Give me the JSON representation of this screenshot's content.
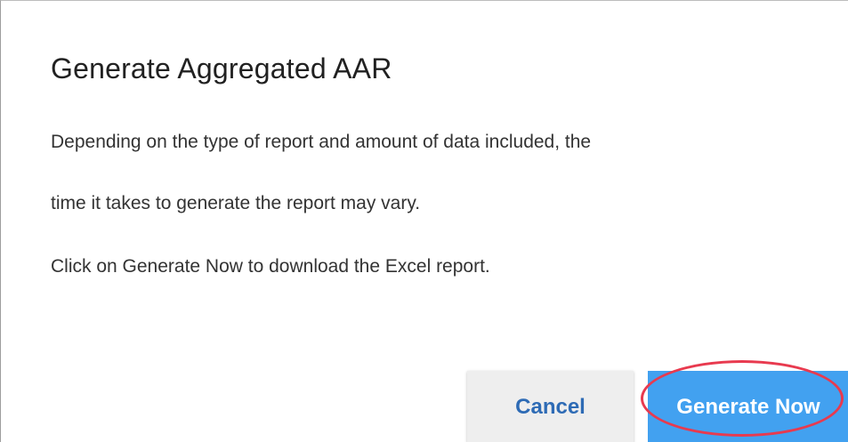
{
  "dialog": {
    "title": "Generate Aggregated AAR",
    "paragraphs": [
      "Depending on the type of report and amount of data included, the",
      "time it takes to generate the report may vary.",
      "Click on Generate Now to download the Excel report."
    ],
    "buttons": {
      "cancel_label": "Cancel",
      "generate_label": "Generate Now"
    }
  },
  "colors": {
    "primary_button": "#42a1f0",
    "secondary_button": "#eeeeee",
    "secondary_button_text": "#2e6bb5",
    "highlight_ring": "#e83a4f"
  }
}
